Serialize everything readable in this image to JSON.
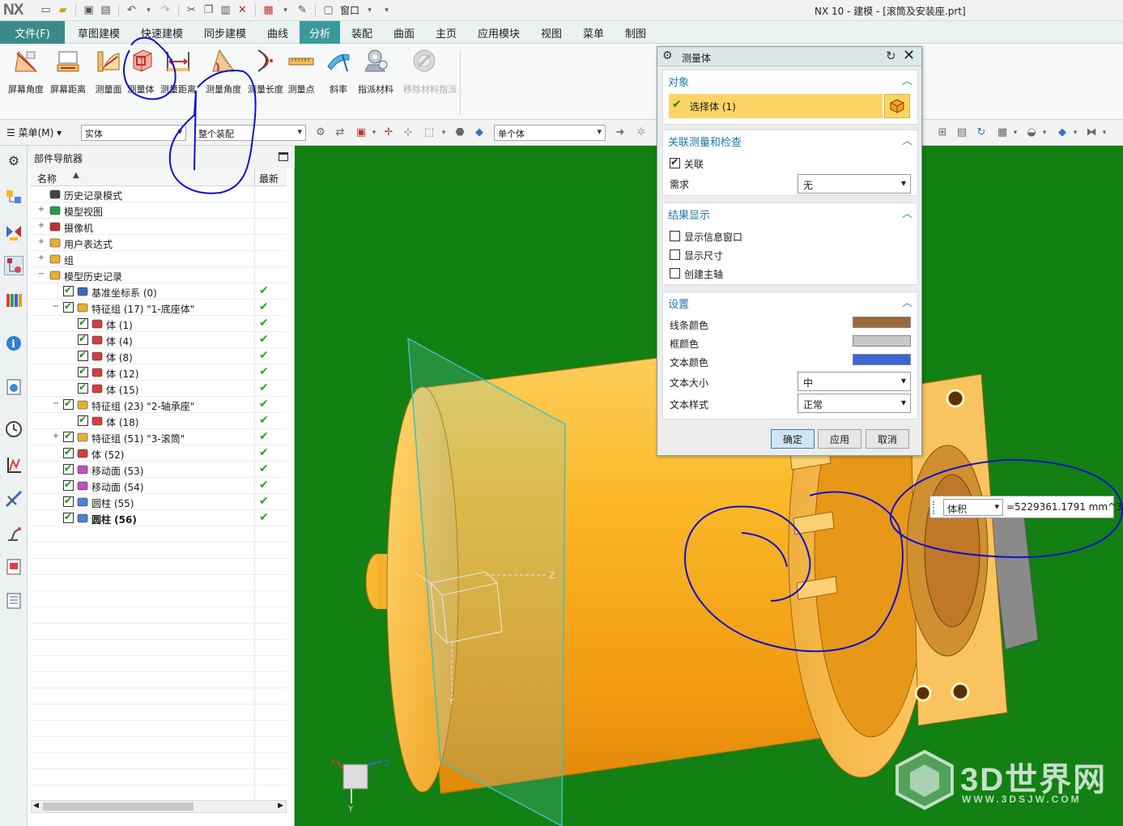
{
  "app": {
    "logo": "NX",
    "window_menu": "窗口",
    "title": "NX 10 - 建模 - [滚筒及安装座.prt]"
  },
  "tabs": {
    "file": "文件(F)",
    "items": [
      "草图建模",
      "快速建模",
      "同步建模",
      "曲线",
      "分析",
      "装配",
      "曲面",
      "主页",
      "应用模块",
      "视图",
      "菜单",
      "制图"
    ],
    "active": "分析"
  },
  "ribbon": {
    "buttons": [
      {
        "label": "屏幕角度",
        "icon": "screen-angle-icon"
      },
      {
        "label": "屏幕距离",
        "icon": "screen-distance-icon"
      },
      {
        "label": "测量面",
        "icon": "measure-face-icon"
      },
      {
        "label": "测量体",
        "icon": "measure-body-icon"
      },
      {
        "label": "测量距离",
        "icon": "measure-distance-icon"
      },
      {
        "label": "测量角度",
        "icon": "measure-angle-icon"
      },
      {
        "label": "测量长度",
        "icon": "measure-length-icon"
      },
      {
        "label": "测量点",
        "icon": "measure-point-icon"
      },
      {
        "label": "斜率",
        "icon": "slope-icon"
      },
      {
        "label": "指派材料",
        "icon": "assign-material-icon"
      },
      {
        "label": "移除材料指派",
        "icon": "remove-material-icon"
      }
    ]
  },
  "selbar": {
    "menu_label": "菜单(M)",
    "filter_type": "实体",
    "filter_scope": "整个装配",
    "body_rule": "单个体"
  },
  "navigator": {
    "title": "部件导航器",
    "col_name": "名称",
    "col_latest": "最新",
    "rows": [
      {
        "text": "历史记录模式",
        "level": 0,
        "icon": "clock-icon",
        "expander": "",
        "check": false,
        "latest": false,
        "bold": false
      },
      {
        "text": "模型视图",
        "level": 0,
        "icon": "model-view-icon",
        "expander": "+",
        "check": false,
        "latest": false,
        "bold": false
      },
      {
        "text": "摄像机",
        "level": 0,
        "icon": "camera-icon",
        "expander": "+",
        "check": false,
        "latest": false,
        "bold": false
      },
      {
        "text": "用户表达式",
        "level": 0,
        "icon": "folder-icon",
        "expander": "+",
        "check": false,
        "latest": false,
        "bold": false
      },
      {
        "text": "组",
        "level": 0,
        "icon": "folder-icon",
        "expander": "+",
        "check": false,
        "latest": false,
        "bold": false
      },
      {
        "text": "模型历史记录",
        "level": 0,
        "icon": "folder-open-icon",
        "expander": "−",
        "check": false,
        "latest": false,
        "bold": false
      },
      {
        "text": "基准坐标系 (0)",
        "level": 1,
        "icon": "datum-csys-icon",
        "expander": "",
        "check": true,
        "latest": true,
        "bold": false
      },
      {
        "text": "特征组 (17) \"1-底座体\"",
        "level": 1,
        "icon": "feature-group-icon",
        "expander": "−",
        "check": true,
        "latest": true,
        "bold": false
      },
      {
        "text": "体 (1)",
        "level": 2,
        "icon": "body-icon",
        "expander": "",
        "check": true,
        "latest": true,
        "bold": false
      },
      {
        "text": "体 (4)",
        "level": 2,
        "icon": "body-icon",
        "expander": "",
        "check": true,
        "latest": true,
        "bold": false
      },
      {
        "text": "体 (8)",
        "level": 2,
        "icon": "body-icon",
        "expander": "",
        "check": true,
        "latest": true,
        "bold": false
      },
      {
        "text": "体 (12)",
        "level": 2,
        "icon": "body-icon",
        "expander": "",
        "check": true,
        "latest": true,
        "bold": false
      },
      {
        "text": "体 (15)",
        "level": 2,
        "icon": "body-icon",
        "expander": "",
        "check": true,
        "latest": true,
        "bold": false
      },
      {
        "text": "特征组 (23) \"2-轴承座\"",
        "level": 1,
        "icon": "feature-group-icon",
        "expander": "−",
        "check": true,
        "latest": true,
        "bold": false
      },
      {
        "text": "体 (18)",
        "level": 2,
        "icon": "body-icon",
        "expander": "",
        "check": true,
        "latest": true,
        "bold": false
      },
      {
        "text": "特征组 (51) \"3-滚筒\"",
        "level": 1,
        "icon": "feature-group-icon",
        "expander": "+",
        "check": true,
        "latest": true,
        "bold": false
      },
      {
        "text": "体 (52)",
        "level": 1,
        "icon": "body-icon",
        "expander": "",
        "check": true,
        "latest": true,
        "bold": false
      },
      {
        "text": "移动面 (53)",
        "level": 1,
        "icon": "move-face-icon",
        "expander": "",
        "check": true,
        "latest": true,
        "bold": false
      },
      {
        "text": "移动面 (54)",
        "level": 1,
        "icon": "move-face-icon",
        "expander": "",
        "check": true,
        "latest": true,
        "bold": false
      },
      {
        "text": "圆柱 (55)",
        "level": 1,
        "icon": "cylinder-icon",
        "expander": "",
        "check": true,
        "latest": true,
        "bold": false
      },
      {
        "text": "圆柱 (56)",
        "level": 1,
        "icon": "cylinder-icon",
        "expander": "",
        "check": true,
        "latest": true,
        "bold": true
      }
    ]
  },
  "dialog": {
    "title": "测量体",
    "object_section": "对象",
    "select_body": "选择体 (1)",
    "assoc_section": "关联测量和检查",
    "assoc_label": "关联",
    "assoc_checked": true,
    "requirement_label": "需求",
    "requirement_value": "无",
    "result_section": "结果显示",
    "show_info_window": "显示信息窗口",
    "show_dimension": "显示尺寸",
    "create_axis": "创建主轴",
    "settings_section": "设置",
    "line_color_label": "线条颜色",
    "frame_color_label": "框颜色",
    "text_color_label": "文本颜色",
    "line_color": "#9b6a3c",
    "frame_color": "#c8c8c8",
    "text_color": "#3a66d4",
    "text_size_label": "文本大小",
    "text_size_value": "中",
    "text_style_label": "文本样式",
    "text_style_value": "正常",
    "ok": "确定",
    "apply": "应用",
    "cancel": "取消"
  },
  "readout": {
    "type": "体积",
    "value": "=5229361.1791 mm^3"
  },
  "viewport": {
    "background": "#128012",
    "part_color": "#f6a81c",
    "axis_z": "Z",
    "axis_y": "Y",
    "triad_x": "X",
    "triad_y": "Y",
    "triad_z": "Z"
  },
  "watermark": {
    "text": "3D世界网",
    "url": "WWW.3DSJW.COM"
  }
}
